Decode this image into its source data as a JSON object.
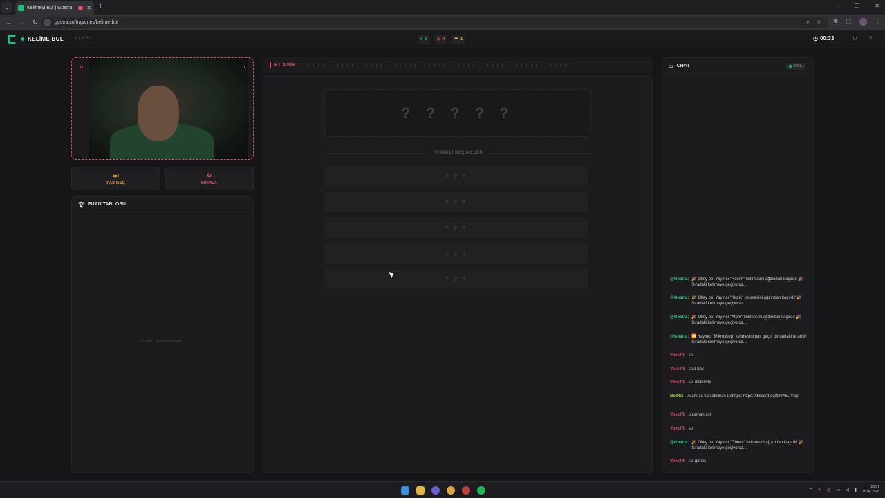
{
  "browser": {
    "tab_title": "Kelimeyi Bul | Gostra",
    "url": "gostra.co/tr/games/kelime-bul"
  },
  "app": {
    "brand": "KELİME BUL",
    "mode_label": "KLASİK",
    "stats": {
      "correct": "0",
      "wrong": "4",
      "passed": "1"
    },
    "timer": "00:33"
  },
  "left": {
    "pass_label": "PAS GEÇ",
    "reset_label": "SIFIRLA",
    "leaderboard_title": "PUAN TABLOSU",
    "leaderboard_empty": "Henüz puan alan yok."
  },
  "center": {
    "mode_label": "KLASİK",
    "hidden_word": "? ? ? ? ?",
    "forbidden_title": "YASAKLI KELİMELER",
    "forbidden": [
      "? ? ?",
      "? ? ?",
      "? ? ?",
      "? ? ?",
      "? ? ?"
    ]
  },
  "chat": {
    "title": "CHAT",
    "live_label": "CANLI",
    "messages": [
      {
        "user": "@Gostra:",
        "color": "#2ecf8a",
        "text": "🎉 Olley be! Yayıncı \"Resim\" kelimesini ağzından kaçırdı! 🎉 Sıradaki kelimeye geçiyoruz..."
      },
      {
        "user": "@Gostra:",
        "color": "#2ecf8a",
        "text": "🎉 Olley be! Yayıncı \"Kirpik\" kelimesini ağzından kaçırdı! 🎉 Sıradaki kelimeye geçiyoruz..."
      },
      {
        "user": "@Gostra:",
        "color": "#2ecf8a",
        "text": "🎉 Olley be! Yayıncı \"Atom\" kelimesini ağzından kaçırdı! 🎉 Sıradaki kelimeye geçiyoruz..."
      },
      {
        "user": "@Gostra:",
        "color": "#2ecf8a",
        "text": "⏩ Yayıncı \"Mikroskop\" kelimesini pas geçti, bir dahakine artık! Sıradaki kelimeye geçiyoruz..."
      },
      {
        "user": "VoesTT:",
        "color": "#e0506a",
        "text": "sol"
      },
      {
        "user": "VoesTT:",
        "color": "#e0506a",
        "text": "sola bak"
      },
      {
        "user": "VoesTT:",
        "color": "#e0506a",
        "text": "sol olabilirmi"
      },
      {
        "user": "BotRix:",
        "color": "#9bd82a",
        "text": "Aramıza katılabilirsin Dchttps: https://discord.gg/fDfrXEJYDp"
      },
      {
        "user": "VoesTT:",
        "color": "#e0506a",
        "text": "o zaman sol"
      },
      {
        "user": "VoesTT:",
        "color": "#e0506a",
        "text": "sol"
      },
      {
        "user": "@Gostra:",
        "color": "#2ecf8a",
        "text": "🎉 Olley be! Yayıncı \"Güneş\" kelimesini ağzından kaçırdı! 🎉 Sıradaki kelimeye geçiyoruz..."
      },
      {
        "user": "VoesTT:",
        "color": "#e0506a",
        "text": "sol güneş"
      }
    ]
  },
  "taskbar": {
    "time": "23:57",
    "date": "15.04.2026"
  }
}
